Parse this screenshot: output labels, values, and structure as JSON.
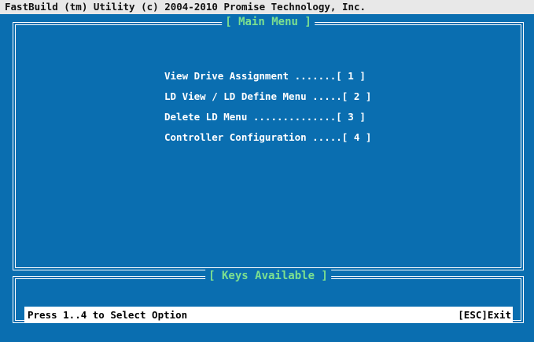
{
  "titlebar": {
    "text": "FastBuild (tm) Utility (c) 2004-2010 Promise Technology, Inc."
  },
  "main_menu": {
    "title": "[ Main Menu ]",
    "items": [
      {
        "label": "View Drive Assignment .......[ 1 ]"
      },
      {
        "label": "LD View / LD Define Menu .....[ 2 ]"
      },
      {
        "label": "Delete LD Menu ..............[ 3 ]"
      },
      {
        "label": "Controller Configuration .....[ 4 ]"
      }
    ]
  },
  "keys": {
    "title": "[ Keys Available ]",
    "hint": "Press 1..4 to Select Option",
    "exit": "[ESC]Exit"
  },
  "colors": {
    "background": "#0a6eb0",
    "title_accent": "#7de08f",
    "menu_text": "#ffffff",
    "titlebar_bg": "#e8e8e8"
  }
}
